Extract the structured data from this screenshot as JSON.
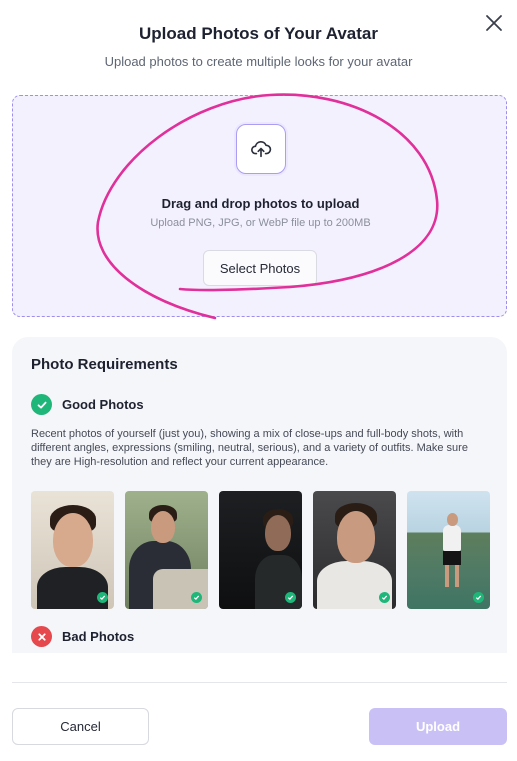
{
  "dialog": {
    "title": "Upload Photos of Your Avatar",
    "subtitle": "Upload photos to create multiple looks for your avatar"
  },
  "dropzone": {
    "icon": "cloud-upload-icon",
    "title": "Drag and drop photos to upload",
    "hint": "Upload PNG, JPG, or WebP file up to 200MB",
    "button_label": "Select Photos"
  },
  "requirements": {
    "title": "Photo Requirements",
    "good": {
      "label": "Good Photos",
      "icon": "check-circle-icon",
      "description": "Recent photos of yourself (just you), showing a mix of close-ups and full-body shots, with different angles, expressions (smiling, neutral, serious), and a variety of outfits. Make sure they are High-resolution and reflect your current appearance."
    },
    "bad": {
      "label": "Bad Photos",
      "icon": "x-circle-icon"
    }
  },
  "footer": {
    "cancel_label": "Cancel",
    "upload_label": "Upload"
  },
  "colors": {
    "accent": "#9d8ff0",
    "good": "#1fb67a",
    "bad": "#e5484d",
    "upload_disabled": "#c9c1f6"
  }
}
